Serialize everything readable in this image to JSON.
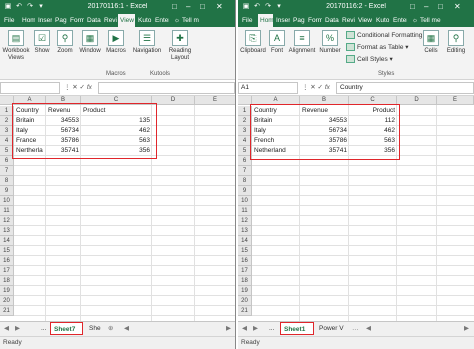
{
  "left": {
    "title": "20170116:1 - Excel",
    "tell_me": "Tell m",
    "tabs": [
      "File",
      "Hom",
      "Inser",
      "Pag",
      "Form",
      "Data",
      "Revi",
      "View",
      "Kuto",
      "Enter"
    ],
    "active_tab": "View",
    "ribbon": {
      "workbook_views": "Workbook Views",
      "show": "Show",
      "zoom": "Zoom",
      "window": "Window",
      "macros": "Macros",
      "navigation": "Navigation",
      "reading_layout": "Reading Layout",
      "group_macros": "Macros",
      "group_kutools": "Kutools"
    },
    "name_box": "",
    "formula": "",
    "columns": [
      "A",
      "B",
      "C",
      "D",
      "E"
    ],
    "rows": [
      "1",
      "2",
      "3",
      "4",
      "5",
      "6",
      "7",
      "8",
      "9",
      "10",
      "11",
      "12",
      "13",
      "14",
      "15",
      "16",
      "17",
      "18",
      "19",
      "20",
      "21"
    ],
    "headers": [
      "Country",
      "Revenu",
      "Product"
    ],
    "data": [
      [
        "Britain",
        "34553",
        "135"
      ],
      [
        "Italy",
        "56734",
        "462"
      ],
      [
        "France",
        "35786",
        "563"
      ],
      [
        "Nertherla",
        "35741",
        "356"
      ]
    ],
    "sheet_tabs": [
      "...",
      "Sheet7",
      "She"
    ],
    "active_sheet": "Sheet7",
    "status": "Ready"
  },
  "right": {
    "title": "20170116:2 - Excel",
    "tell_me": "Tell me",
    "tabs": [
      "File",
      "Hom",
      "Inser",
      "Pag",
      "Form",
      "Data",
      "Revi",
      "View",
      "Kuto",
      "Enter"
    ],
    "active_tab": "Hom",
    "ribbon": {
      "clipboard": "Clipboard",
      "font": "Font",
      "alignment": "Alignment",
      "number": "Number",
      "conditional_formatting": "Conditional Formatting",
      "format_as_table": "Format as Table",
      "cell_styles": "Cell Styles",
      "group_styles": "Styles",
      "cells": "Cells",
      "editing": "Editing"
    },
    "name_box": "A1",
    "formula": "Country",
    "columns": [
      "A",
      "B",
      "C",
      "D",
      "E"
    ],
    "rows": [
      "1",
      "2",
      "3",
      "4",
      "5",
      "6",
      "7",
      "8",
      "9",
      "10",
      "11",
      "12",
      "13",
      "14",
      "15",
      "16",
      "17",
      "18",
      "19",
      "20",
      "21"
    ],
    "headers": [
      "Country",
      "Revenue",
      "Product"
    ],
    "data": [
      [
        "Britain",
        "34553",
        "112"
      ],
      [
        "Italy",
        "56734",
        "462"
      ],
      [
        "French",
        "35786",
        "563"
      ],
      [
        "Netherland",
        "35741",
        "356"
      ]
    ],
    "sheet_tabs": [
      "...",
      "Sheet1",
      "Power V"
    ],
    "active_sheet": "Sheet1",
    "status": "Ready"
  }
}
